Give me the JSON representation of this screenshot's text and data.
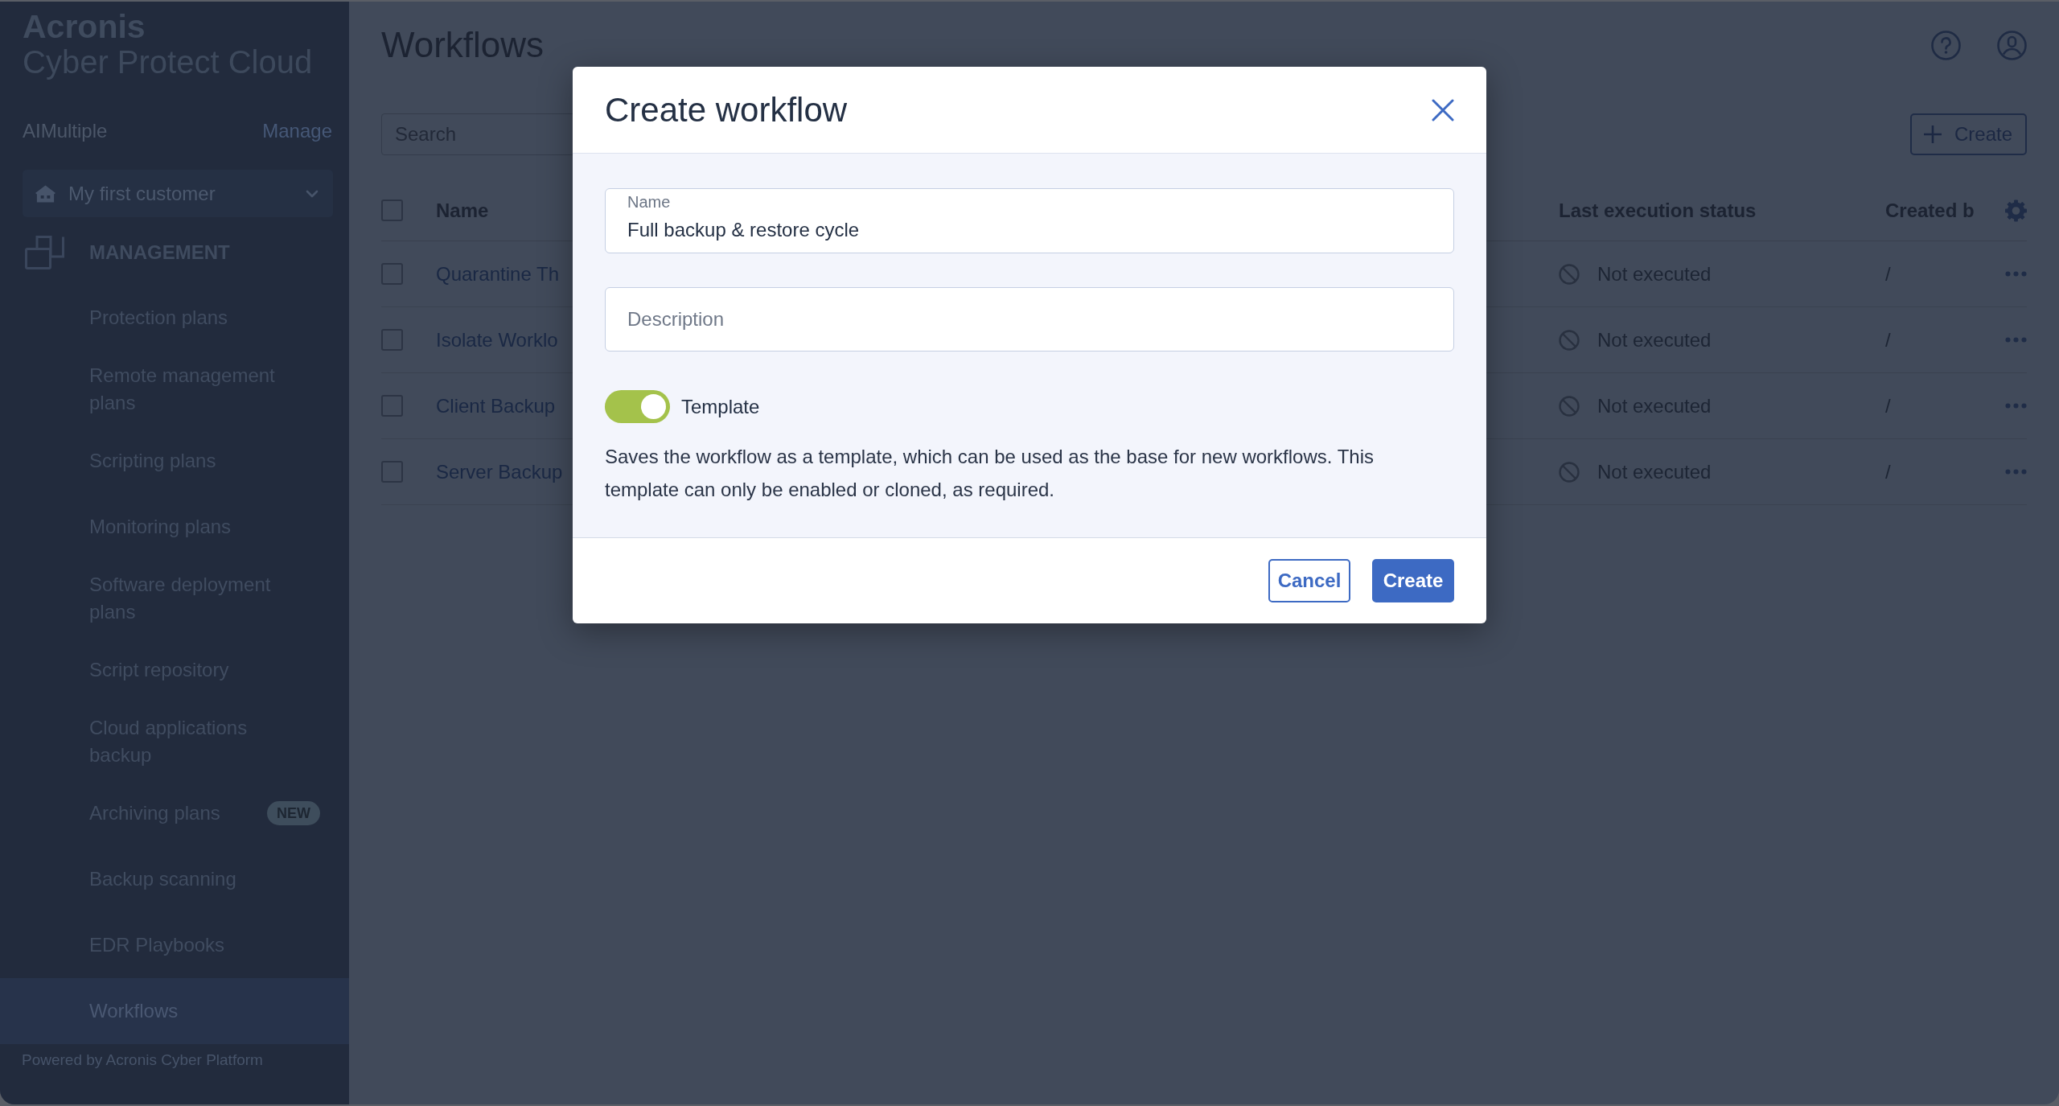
{
  "sidebar": {
    "logo": {
      "brand": "Acronis",
      "product": "Cyber Protect Cloud"
    },
    "account": {
      "name": "AIMultiple",
      "action": "Manage"
    },
    "customer_selector": {
      "value": "My first customer"
    },
    "section": {
      "title": "MANAGEMENT"
    },
    "items": [
      {
        "label": "Protection plans",
        "selected": false
      },
      {
        "label": "Remote management plans",
        "selected": false
      },
      {
        "label": "Scripting plans",
        "selected": false
      },
      {
        "label": "Monitoring plans",
        "selected": false
      },
      {
        "label": "Software deployment plans",
        "selected": false
      },
      {
        "label": "Script repository",
        "selected": false
      },
      {
        "label": "Cloud applications backup",
        "selected": false
      },
      {
        "label": "Archiving plans",
        "selected": false,
        "badge": "NEW"
      },
      {
        "label": "Backup scanning",
        "selected": false
      },
      {
        "label": "EDR Playbooks",
        "selected": false
      },
      {
        "label": "Workflows",
        "selected": true
      }
    ],
    "footer": "Powered by Acronis Cyber Platform"
  },
  "page": {
    "title": "Workflows",
    "search": {
      "placeholder": "Search"
    },
    "create_button": {
      "label": "Create"
    }
  },
  "table": {
    "select_all": {
      "checked": false
    },
    "columns": [
      "Name",
      "Last execution status",
      "Created b"
    ],
    "rows": [
      {
        "checked": false,
        "name": "Quarantine Th",
        "status": "Not executed",
        "created_by": "/"
      },
      {
        "checked": false,
        "name": "Isolate Worklo",
        "status": "Not executed",
        "created_by": "/"
      },
      {
        "checked": false,
        "name": "Client Backup",
        "status": "Not executed",
        "created_by": "/"
      },
      {
        "checked": false,
        "name": "Server Backup",
        "status": "Not executed",
        "created_by": "/"
      }
    ]
  },
  "dialog": {
    "title": "Create workflow",
    "fields": [
      {
        "label": "Name",
        "value": "Full backup & restore cycle"
      },
      {
        "placeholder": "Description"
      }
    ],
    "template_toggle": {
      "label": "Template",
      "on": true
    },
    "help_text": "Saves the workflow as a template, which can be used as the base for new workflows. This template can only be enabled or cloned, as required.",
    "buttons": [
      {
        "label": "Cancel",
        "kind": "secondary"
      },
      {
        "label": "Create",
        "kind": "primary"
      }
    ]
  }
}
